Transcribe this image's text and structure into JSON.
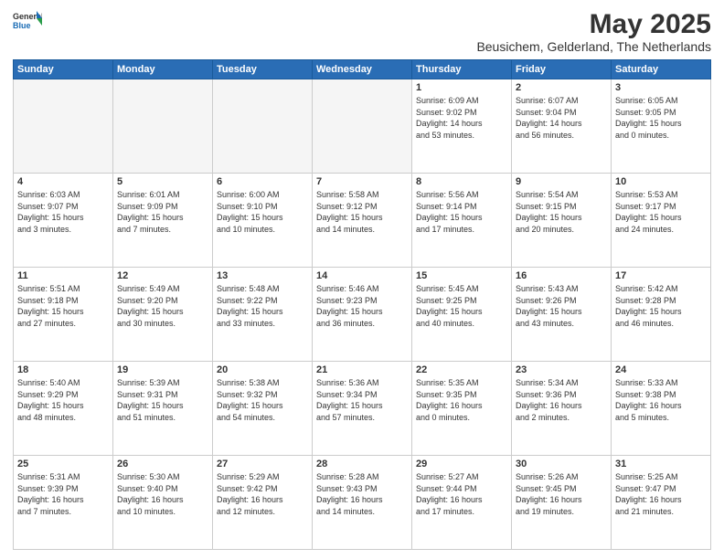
{
  "header": {
    "logo_general": "General",
    "logo_blue": "Blue",
    "title": "May 2025",
    "subtitle": "Beusichem, Gelderland, The Netherlands"
  },
  "weekdays": [
    "Sunday",
    "Monday",
    "Tuesday",
    "Wednesday",
    "Thursday",
    "Friday",
    "Saturday"
  ],
  "weeks": [
    [
      {
        "day": "",
        "info": ""
      },
      {
        "day": "",
        "info": ""
      },
      {
        "day": "",
        "info": ""
      },
      {
        "day": "",
        "info": ""
      },
      {
        "day": "1",
        "info": "Sunrise: 6:09 AM\nSunset: 9:02 PM\nDaylight: 14 hours\nand 53 minutes."
      },
      {
        "day": "2",
        "info": "Sunrise: 6:07 AM\nSunset: 9:04 PM\nDaylight: 14 hours\nand 56 minutes."
      },
      {
        "day": "3",
        "info": "Sunrise: 6:05 AM\nSunset: 9:05 PM\nDaylight: 15 hours\nand 0 minutes."
      }
    ],
    [
      {
        "day": "4",
        "info": "Sunrise: 6:03 AM\nSunset: 9:07 PM\nDaylight: 15 hours\nand 3 minutes."
      },
      {
        "day": "5",
        "info": "Sunrise: 6:01 AM\nSunset: 9:09 PM\nDaylight: 15 hours\nand 7 minutes."
      },
      {
        "day": "6",
        "info": "Sunrise: 6:00 AM\nSunset: 9:10 PM\nDaylight: 15 hours\nand 10 minutes."
      },
      {
        "day": "7",
        "info": "Sunrise: 5:58 AM\nSunset: 9:12 PM\nDaylight: 15 hours\nand 14 minutes."
      },
      {
        "day": "8",
        "info": "Sunrise: 5:56 AM\nSunset: 9:14 PM\nDaylight: 15 hours\nand 17 minutes."
      },
      {
        "day": "9",
        "info": "Sunrise: 5:54 AM\nSunset: 9:15 PM\nDaylight: 15 hours\nand 20 minutes."
      },
      {
        "day": "10",
        "info": "Sunrise: 5:53 AM\nSunset: 9:17 PM\nDaylight: 15 hours\nand 24 minutes."
      }
    ],
    [
      {
        "day": "11",
        "info": "Sunrise: 5:51 AM\nSunset: 9:18 PM\nDaylight: 15 hours\nand 27 minutes."
      },
      {
        "day": "12",
        "info": "Sunrise: 5:49 AM\nSunset: 9:20 PM\nDaylight: 15 hours\nand 30 minutes."
      },
      {
        "day": "13",
        "info": "Sunrise: 5:48 AM\nSunset: 9:22 PM\nDaylight: 15 hours\nand 33 minutes."
      },
      {
        "day": "14",
        "info": "Sunrise: 5:46 AM\nSunset: 9:23 PM\nDaylight: 15 hours\nand 36 minutes."
      },
      {
        "day": "15",
        "info": "Sunrise: 5:45 AM\nSunset: 9:25 PM\nDaylight: 15 hours\nand 40 minutes."
      },
      {
        "day": "16",
        "info": "Sunrise: 5:43 AM\nSunset: 9:26 PM\nDaylight: 15 hours\nand 43 minutes."
      },
      {
        "day": "17",
        "info": "Sunrise: 5:42 AM\nSunset: 9:28 PM\nDaylight: 15 hours\nand 46 minutes."
      }
    ],
    [
      {
        "day": "18",
        "info": "Sunrise: 5:40 AM\nSunset: 9:29 PM\nDaylight: 15 hours\nand 48 minutes."
      },
      {
        "day": "19",
        "info": "Sunrise: 5:39 AM\nSunset: 9:31 PM\nDaylight: 15 hours\nand 51 minutes."
      },
      {
        "day": "20",
        "info": "Sunrise: 5:38 AM\nSunset: 9:32 PM\nDaylight: 15 hours\nand 54 minutes."
      },
      {
        "day": "21",
        "info": "Sunrise: 5:36 AM\nSunset: 9:34 PM\nDaylight: 15 hours\nand 57 minutes."
      },
      {
        "day": "22",
        "info": "Sunrise: 5:35 AM\nSunset: 9:35 PM\nDaylight: 16 hours\nand 0 minutes."
      },
      {
        "day": "23",
        "info": "Sunrise: 5:34 AM\nSunset: 9:36 PM\nDaylight: 16 hours\nand 2 minutes."
      },
      {
        "day": "24",
        "info": "Sunrise: 5:33 AM\nSunset: 9:38 PM\nDaylight: 16 hours\nand 5 minutes."
      }
    ],
    [
      {
        "day": "25",
        "info": "Sunrise: 5:31 AM\nSunset: 9:39 PM\nDaylight: 16 hours\nand 7 minutes."
      },
      {
        "day": "26",
        "info": "Sunrise: 5:30 AM\nSunset: 9:40 PM\nDaylight: 16 hours\nand 10 minutes."
      },
      {
        "day": "27",
        "info": "Sunrise: 5:29 AM\nSunset: 9:42 PM\nDaylight: 16 hours\nand 12 minutes."
      },
      {
        "day": "28",
        "info": "Sunrise: 5:28 AM\nSunset: 9:43 PM\nDaylight: 16 hours\nand 14 minutes."
      },
      {
        "day": "29",
        "info": "Sunrise: 5:27 AM\nSunset: 9:44 PM\nDaylight: 16 hours\nand 17 minutes."
      },
      {
        "day": "30",
        "info": "Sunrise: 5:26 AM\nSunset: 9:45 PM\nDaylight: 16 hours\nand 19 minutes."
      },
      {
        "day": "31",
        "info": "Sunrise: 5:25 AM\nSunset: 9:47 PM\nDaylight: 16 hours\nand 21 minutes."
      }
    ]
  ]
}
